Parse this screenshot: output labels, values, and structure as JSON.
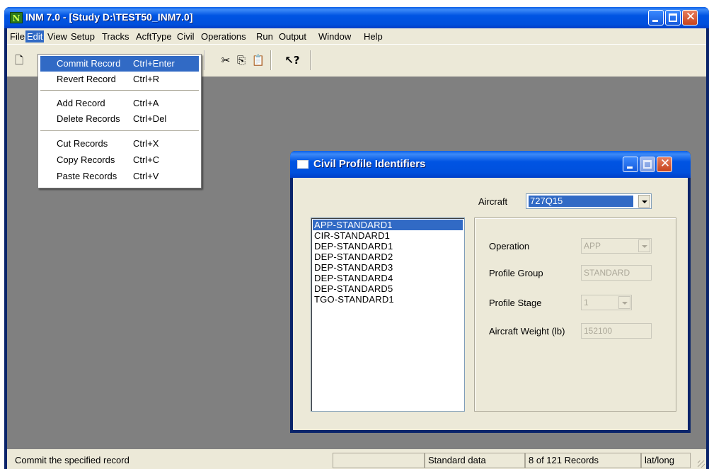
{
  "window": {
    "icon_text": "N",
    "title": "INM 7.0 - [Study D:\\TEST50_INM7.0]"
  },
  "menu_bar": {
    "items": [
      "File",
      "Edit",
      "View",
      "Setup",
      "Tracks",
      "AcftType",
      "Civil",
      "Operations",
      "Run",
      "Output",
      "Window",
      "Help"
    ],
    "active": "Edit"
  },
  "toolbar": {
    "buttons": [
      "new-document-icon",
      "cut-icon",
      "copy-icon",
      "paste-icon",
      "context-help-icon"
    ]
  },
  "edit_menu": {
    "items": [
      {
        "label": "Commit Record",
        "shortcut": "Ctrl+Enter"
      },
      {
        "label": "Revert Record",
        "shortcut": "Ctrl+R"
      },
      {
        "label": "Add Record",
        "shortcut": "Ctrl+A"
      },
      {
        "label": "Delete Records",
        "shortcut": "Ctrl+Del"
      },
      {
        "label": "Cut Records",
        "shortcut": "Ctrl+X"
      },
      {
        "label": "Copy Records",
        "shortcut": "Ctrl+C"
      },
      {
        "label": "Paste Records",
        "shortcut": "Ctrl+V"
      }
    ],
    "highlighted": "Commit Record"
  },
  "dialog": {
    "title": "Civil Profile Identifiers",
    "aircraft_label": "Aircraft",
    "aircraft_value": "727Q15",
    "profiles": [
      "APP-STANDARD1",
      "CIR-STANDARD1",
      "DEP-STANDARD1",
      "DEP-STANDARD2",
      "DEP-STANDARD3",
      "DEP-STANDARD4",
      "DEP-STANDARD5",
      "TGO-STANDARD1"
    ],
    "selected_profile": "APP-STANDARD1",
    "fields": {
      "operation_label": "Operation",
      "operation_value": "APP",
      "profile_group_label": "Profile Group",
      "profile_group_value": "STANDARD",
      "profile_stage_label": "Profile Stage",
      "profile_stage_value": "1",
      "aircraft_weight_label": "Aircraft Weight (lb)",
      "aircraft_weight_value": "152100"
    }
  },
  "status_bar": {
    "message": "Commit the specified record",
    "pane2": "",
    "data_source": "Standard data",
    "record_count": "8 of 121 Records",
    "coords": "lat/long"
  },
  "colors": {
    "title_bar": "#0054e3",
    "menu_highlight": "#316ac5",
    "mdi_background": "#808080",
    "face": "#ece9d8"
  }
}
